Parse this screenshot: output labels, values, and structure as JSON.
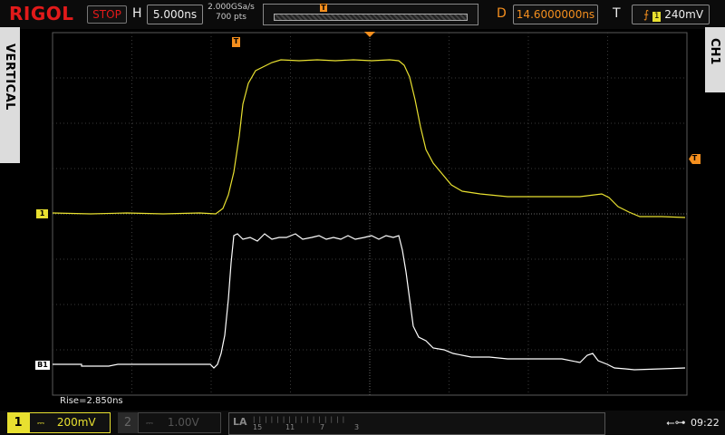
{
  "header": {
    "brand": "RIGOL",
    "run_state": "STOP",
    "horizontal_letter": "H",
    "timebase": "5.000ns",
    "sample_rate": "2.000GSa/s",
    "memory_depth": "700 pts",
    "delay_letter": "D",
    "delay": "14.6000000ns",
    "trigger_letter": "T",
    "trigger_source_badge": "1",
    "trigger_level": "240mV",
    "trigger_marker": "T"
  },
  "side_tabs": {
    "left": "VERTICAL",
    "right": "CH1"
  },
  "markers": {
    "trigger_position": "T",
    "trigger_level_marker": "T",
    "ch1_ground": "1",
    "bus1_ground": "B1"
  },
  "measurement": "Rise=2.850ns",
  "bottom": {
    "ch1_number": "1",
    "ch1_scale": "200mV",
    "ch2_number": "2",
    "ch2_scale": "1.00V",
    "la_label": "LA",
    "la_channels": [
      "15",
      "11",
      "7",
      "3"
    ],
    "clock": "09:22"
  },
  "colors": {
    "ch1": "#e8e030",
    "bus": "#ffffff",
    "accent": "#f58f1e",
    "brand": "#e21a1a",
    "grid": "#5a5a5a"
  },
  "icons": {
    "trigger_edge": "rising-edge-icon",
    "usb": "usb-icon"
  }
}
